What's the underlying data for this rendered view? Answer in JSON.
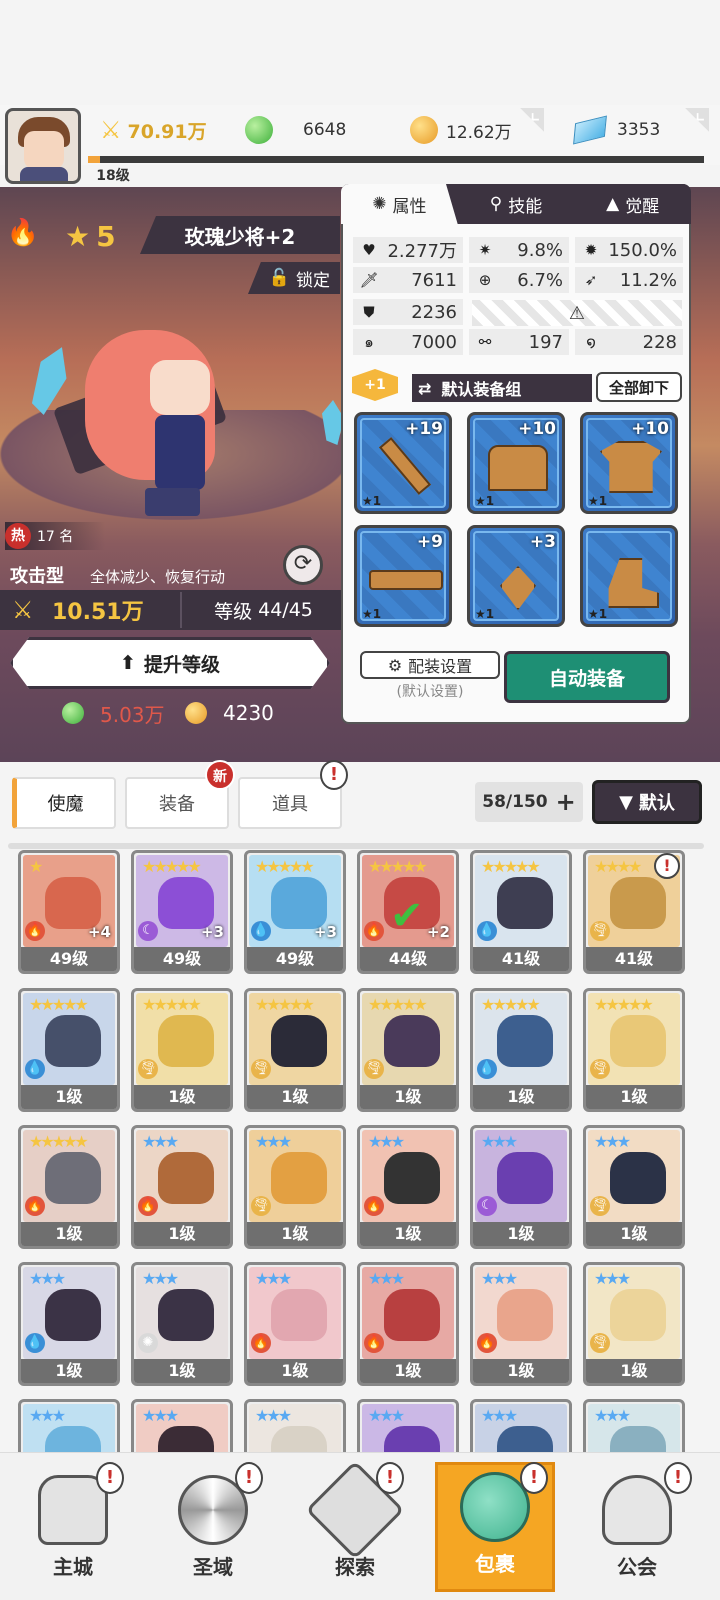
{
  "topbar": {
    "power": "70.91万",
    "gems": "6648",
    "gold": "12.62万",
    "crystals": "3353",
    "level": "18级",
    "xp_progress": 0.02
  },
  "hero": {
    "stars": "5",
    "name": "玫瑰少将+2",
    "lock_label": "锁定",
    "hot_label": "热",
    "rank": "17 名",
    "type": "攻击型",
    "skill_desc": "全体减少、恢复行动",
    "power": "10.51万",
    "level_label": "等级",
    "level": "44/45",
    "upgrade_label": "提升等级",
    "cost_gems": "5.03万",
    "cost_gold": "4230"
  },
  "panel": {
    "tabs": [
      {
        "label": "属性",
        "icon": "attribute-icon"
      },
      {
        "label": "技能",
        "icon": "skill-icon"
      },
      {
        "label": "觉醒",
        "icon": "awaken-icon"
      }
    ],
    "stats": {
      "hp": "2.277万",
      "crit_rate": "9.8%",
      "crit_dmg": "150.0%",
      "atk": "7611",
      "accuracy": "6.7%",
      "speed_rate": "11.2%",
      "def": "2236",
      "stat7": "7000",
      "stat8": "197",
      "stat9": "228"
    },
    "set_badge": "+1",
    "set_label": "默认装备组",
    "unequip_all": "全部卸下",
    "equipment": [
      {
        "plus": "+19",
        "stars": "★1",
        "item": "sword"
      },
      {
        "plus": "+10",
        "stars": "★1",
        "item": "chest"
      },
      {
        "plus": "+10",
        "stars": "★1",
        "item": "armor"
      },
      {
        "plus": "+9",
        "stars": "★1",
        "item": "belt"
      },
      {
        "plus": "+3",
        "stars": "★1",
        "item": "necklace"
      },
      {
        "plus": "",
        "stars": "★1",
        "item": "boots"
      }
    ],
    "config_label": "配装设置",
    "config_sub": "(默认设置)",
    "auto_equip": "自动装备"
  },
  "inventory": {
    "tabs": [
      "使魔",
      "装备",
      "道具"
    ],
    "new_badge": "新",
    "alert": "!",
    "count": "58/150",
    "count_plus": "+",
    "sort": "默认"
  },
  "grid": [
    {
      "stars": "★",
      "level": "49级",
      "plus": "+4",
      "elem": "fire",
      "color": "#e8a08a",
      "head": "#d8674e",
      "star_color": "#f5c542"
    },
    {
      "stars": "★★★★★",
      "level": "49级",
      "plus": "+3",
      "elem": "dark",
      "color": "#cdb9e6",
      "head": "#8c4fd6",
      "star_color": "#f5c542"
    },
    {
      "stars": "★★★★★",
      "level": "49级",
      "plus": "+3",
      "elem": "water",
      "color": "#b6def2",
      "head": "#5aa9dc",
      "star_color": "#f5c542"
    },
    {
      "stars": "★★★★★",
      "level": "44级",
      "plus": "+2",
      "elem": "fire",
      "color": "#e49a8e",
      "head": "#c64a45",
      "star_color": "#f5c542",
      "check": "✔"
    },
    {
      "stars": "★★★★★",
      "level": "41级",
      "plus": "",
      "elem": "water",
      "color": "#d9e4ee",
      "head": "#3e3e52",
      "star_color": "#f5c542"
    },
    {
      "stars": "★★★★",
      "level": "41级",
      "plus": "",
      "elem": "wind",
      "color": "#efd09a",
      "head": "#c99a4c",
      "star_color": "#f5c542",
      "alert": "!"
    },
    {
      "stars": "★★★★★",
      "level": "1级",
      "plus": "",
      "elem": "water",
      "color": "#c8d6ea",
      "head": "#46506a",
      "star_color": "#f5c542"
    },
    {
      "stars": "★★★★★",
      "level": "1级",
      "plus": "",
      "elem": "wind",
      "color": "#f1dfa8",
      "head": "#e0b850",
      "star_color": "#f5c542"
    },
    {
      "stars": "★★★★★",
      "level": "1级",
      "plus": "",
      "elem": "wind",
      "color": "#efd6a2",
      "head": "#2b2b38",
      "star_color": "#f5c542"
    },
    {
      "stars": "★★★★★",
      "level": "1级",
      "plus": "",
      "elem": "wind",
      "color": "#e7d8b0",
      "head": "#4a3a5a",
      "star_color": "#f5c542"
    },
    {
      "stars": "★★★★★",
      "level": "1级",
      "plus": "",
      "elem": "water",
      "color": "#dce4ec",
      "head": "#3d5f8f",
      "star_color": "#f5c542"
    },
    {
      "stars": "★★★★★",
      "level": "1级",
      "plus": "",
      "elem": "wind",
      "color": "#f2e2b4",
      "head": "#e9c877",
      "star_color": "#f5c542"
    },
    {
      "stars": "★★★★★",
      "level": "1级",
      "plus": "",
      "elem": "fire",
      "color": "#e6cfc6",
      "head": "#6e6e78",
      "star_color": "#f5c542"
    },
    {
      "stars": "★★★",
      "level": "1级",
      "plus": "",
      "elem": "fire",
      "color": "#ecd6c6",
      "head": "#b06a3a",
      "star_color": "#59a9f2"
    },
    {
      "stars": "★★★",
      "level": "1级",
      "plus": "",
      "elem": "wind",
      "color": "#efcf9a",
      "head": "#e3a042",
      "star_color": "#59a9f2"
    },
    {
      "stars": "★★★",
      "level": "1级",
      "plus": "",
      "elem": "fire",
      "color": "#f1c2b2",
      "head": "#333333",
      "star_color": "#59a9f2"
    },
    {
      "stars": "★★★",
      "level": "1级",
      "plus": "",
      "elem": "dark",
      "color": "#c8b4de",
      "head": "#6a3fb0",
      "star_color": "#59a9f2"
    },
    {
      "stars": "★★★",
      "level": "1级",
      "plus": "",
      "elem": "wind",
      "color": "#f2dcc4",
      "head": "#2b3247",
      "star_color": "#59a9f2"
    },
    {
      "stars": "★★★",
      "level": "1级",
      "plus": "",
      "elem": "water",
      "color": "#d8d8e6",
      "head": "#3b3346",
      "star_color": "#59a9f2"
    },
    {
      "stars": "★★★",
      "level": "1级",
      "plus": "",
      "elem": "light",
      "color": "#e6e0e0",
      "head": "#3b3346",
      "star_color": "#59a9f2"
    },
    {
      "stars": "★★★",
      "level": "1级",
      "plus": "",
      "elem": "fire",
      "color": "#f1c8cc",
      "head": "#e2a7b0",
      "star_color": "#59a9f2"
    },
    {
      "stars": "★★★",
      "level": "1级",
      "plus": "",
      "elem": "fire",
      "color": "#e7a9a4",
      "head": "#b84040",
      "star_color": "#59a9f2"
    },
    {
      "stars": "★★★",
      "level": "1级",
      "plus": "",
      "elem": "fire",
      "color": "#f2d8cf",
      "head": "#e9a58c",
      "star_color": "#59a9f2"
    },
    {
      "stars": "★★★",
      "level": "1级",
      "plus": "",
      "elem": "wind",
      "color": "#f2e6c6",
      "head": "#ecd49a",
      "star_color": "#59a9f2"
    },
    {
      "stars": "★★★",
      "level": "",
      "plus": "",
      "elem": "",
      "color": "#bfe0f2",
      "head": "#6db4de",
      "star_color": "#59a9f2"
    },
    {
      "stars": "★★★",
      "level": "",
      "plus": "",
      "elem": "",
      "color": "#f0ccc4",
      "head": "#3b2c36",
      "star_color": "#59a9f2"
    },
    {
      "stars": "★★★",
      "level": "",
      "plus": "",
      "elem": "",
      "color": "#ece6e0",
      "head": "#d9d2c6",
      "star_color": "#59a9f2"
    },
    {
      "stars": "★★★",
      "level": "",
      "plus": "",
      "elem": "",
      "color": "#cbb8e6",
      "head": "#6a3fb0",
      "star_color": "#59a9f2"
    },
    {
      "stars": "★★★",
      "level": "",
      "plus": "",
      "elem": "",
      "color": "#c8d2e6",
      "head": "#3d5f8f",
      "star_color": "#59a9f2"
    },
    {
      "stars": "★★★",
      "level": "",
      "plus": "",
      "elem": "",
      "color": "#d6e6ea",
      "head": "#8ab0c0",
      "star_color": "#59a9f2"
    }
  ],
  "nav": [
    {
      "label": "主城",
      "icon": "castle-icon",
      "badge": "!"
    },
    {
      "label": "圣域",
      "icon": "portal-icon",
      "badge": "!"
    },
    {
      "label": "探索",
      "icon": "sword-icon",
      "badge": "!"
    },
    {
      "label": "包裹",
      "icon": "bag-icon",
      "badge": "!",
      "active": true
    },
    {
      "label": "公会",
      "icon": "guild-icon",
      "badge": "!"
    }
  ],
  "colors": {
    "accent": "#f2a33a",
    "dark": "#3c3340",
    "auto_equip": "#1e8f74",
    "gold_text": "#f5c542",
    "cost_red": "#e0584a"
  }
}
